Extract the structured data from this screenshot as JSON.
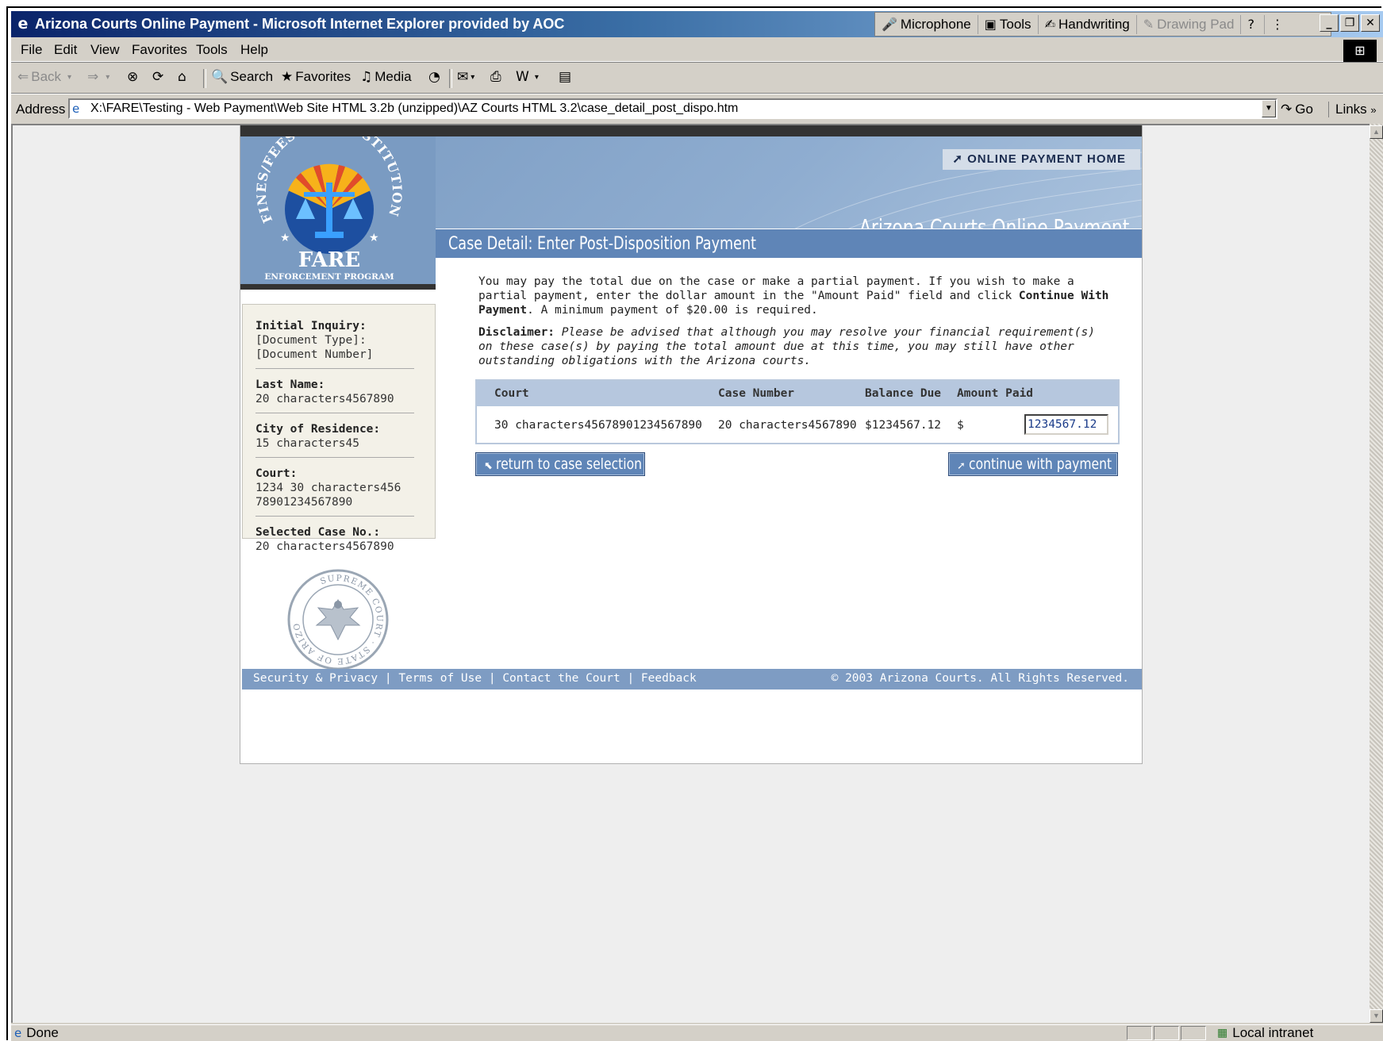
{
  "window": {
    "title": "Arizona Courts Online Payment - Microsoft Internet Explorer provided by AOC",
    "langbar": [
      {
        "label": "Microphone",
        "icon": "microphone-icon",
        "enabled": true
      },
      {
        "label": "Tools",
        "icon": "tools-icon",
        "enabled": true
      },
      {
        "label": "Handwriting",
        "icon": "handwriting-icon",
        "enabled": true
      },
      {
        "label": "Drawing Pad",
        "icon": "drawing-pad-icon",
        "enabled": false
      }
    ]
  },
  "menu": {
    "items": [
      "File",
      "Edit",
      "View",
      "Favorites",
      "Tools",
      "Help"
    ]
  },
  "toolbar": {
    "back": "Back",
    "search": "Search",
    "favorites": "Favorites",
    "media": "Media"
  },
  "address": {
    "label": "Address",
    "url": "X:\\FARE\\Testing - Web Payment\\Web Site HTML 3.2b (unzipped)\\AZ Courts HTML 3.2\\case_detail_post_dispo.htm",
    "go": "Go",
    "links": "Links"
  },
  "status": {
    "text": "Done",
    "zone": "Local intranet"
  },
  "site": {
    "home_link": "ONLINE PAYMENT HOME",
    "title": "Arizona Courts Online Payment",
    "logo_ring_text": "FINES/FEES AND RESTITUTION",
    "logo_name": "FARE",
    "logo_sub": "ENFORCEMENT PROGRAM",
    "page_heading": "Case Detail: Enter Post-Disposition Payment",
    "seal_text": "SUPREME COURT · STATE OF ARIZONA"
  },
  "sidebar": {
    "inquiry_label": "Initial Inquiry:",
    "inquiry_line1": "[Document Type]:",
    "inquiry_line2": "[Document Number]",
    "lastname_label": "Last Name:",
    "lastname_value": "20 characters4567890",
    "city_label": "City of Residence:",
    "city_value": "15 characters45",
    "court_label": "Court:",
    "court_line1": "1234 30 characters456",
    "court_line2": "78901234567890",
    "case_label": "Selected Case No.:",
    "case_value": "20 characters4567890"
  },
  "content": {
    "intro_a": "You may pay the total due on the case or make a partial payment. If you wish to make a partial payment, enter the dollar amount in the \"Amount Paid\" field and click ",
    "intro_bold": "Continue With Payment",
    "intro_b": ". A minimum payment of $20.00 is required.",
    "disclaimer_label": "Disclaimer:",
    "disclaimer_text": "Please be advised that although you may resolve your financial requirement(s) on these case(s) by paying the total amount due at this time, you may still have other outstanding obligations with the Arizona courts."
  },
  "table": {
    "headers": {
      "court": "Court",
      "case_number": "Case Number",
      "balance_due": "Balance Due",
      "amount_paid": "Amount Paid"
    },
    "row": {
      "court": "30 characters45678901234567890",
      "case_number": "20 characters4567890",
      "balance_due": "$1234567.12",
      "currency": "$",
      "amount_paid": "1234567.12"
    }
  },
  "buttons": {
    "return": "return to case selection",
    "continue": "continue with payment"
  },
  "footer": {
    "links": [
      "Security & Privacy",
      "Terms of Use",
      "Contact the Court",
      "Feedback"
    ],
    "separator": "|",
    "copyright": "© 2003 Arizona Courts. All Rights Reserved."
  }
}
